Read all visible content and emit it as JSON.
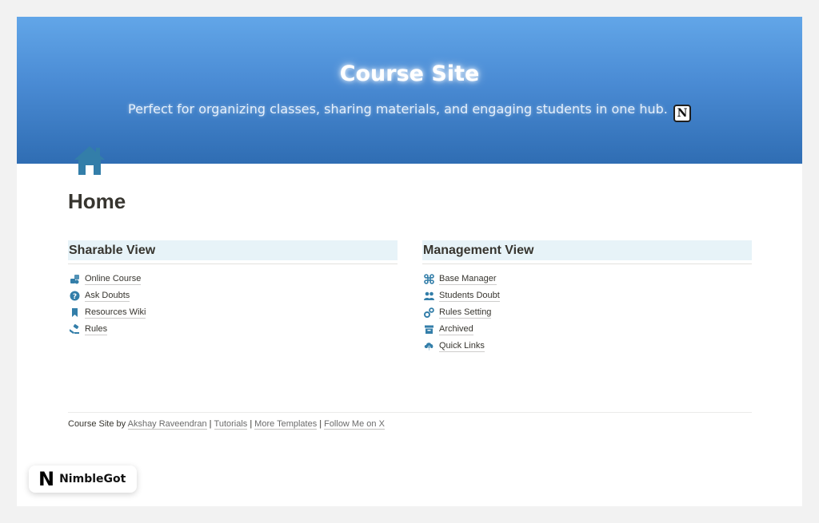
{
  "banner": {
    "title": "Course Site",
    "subtitle": "Perfect for organizing classes, sharing materials, and engaging students in one hub.",
    "notion_mark": "N"
  },
  "page": {
    "title": "Home",
    "icon": "home-icon",
    "accent_color": "#337ea9"
  },
  "sharable": {
    "heading": "Sharable View",
    "items": [
      {
        "label": "Online Course",
        "icon": "course-icon"
      },
      {
        "label": "Ask Doubts",
        "icon": "question-icon"
      },
      {
        "label": "Resources Wiki",
        "icon": "bookmark-icon"
      },
      {
        "label": "Rules",
        "icon": "gavel-icon"
      }
    ]
  },
  "management": {
    "heading": "Management View",
    "items": [
      {
        "label": "Base Manager",
        "icon": "command-icon"
      },
      {
        "label": "Students Doubt",
        "icon": "people-icon"
      },
      {
        "label": "Rules Setting",
        "icon": "gears-icon"
      },
      {
        "label": "Archived",
        "icon": "archive-icon"
      },
      {
        "label": "Quick Links",
        "icon": "cloud-upload-icon"
      }
    ]
  },
  "footer": {
    "prefix": "Course Site by",
    "author": "Akshay Raveendran",
    "tutorials": "Tutorials",
    "templates": "More Templates",
    "follow": "Follow Me on X",
    "separator": "|"
  },
  "brand": {
    "mark": "N",
    "name": "NimbleGot"
  }
}
